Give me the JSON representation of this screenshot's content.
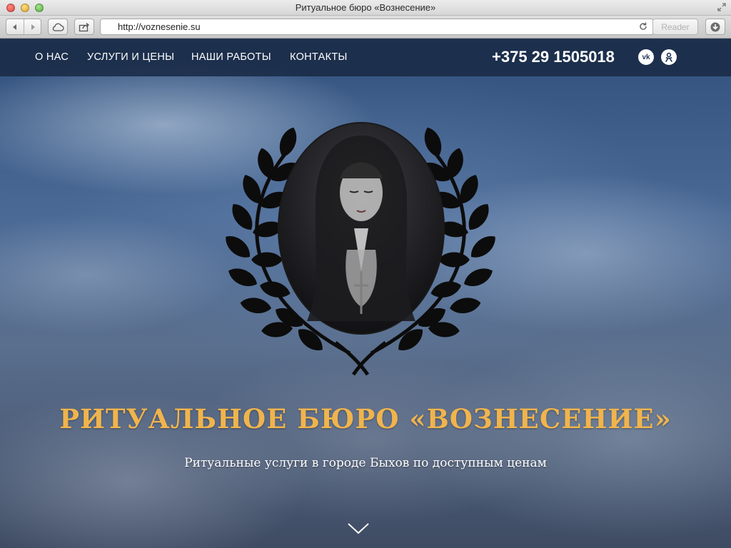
{
  "window": {
    "title": "Ритуальное бюро «Вознесение»"
  },
  "toolbar": {
    "url": "http://voznesenie.su",
    "reader_label": "Reader"
  },
  "nav": {
    "items": [
      {
        "label": "О НАС"
      },
      {
        "label": "УСЛУГИ И ЦЕНЫ"
      },
      {
        "label": "НАШИ РАБОТЫ"
      },
      {
        "label": "КОНТАКТЫ"
      }
    ],
    "phone": "+375 29 1505018",
    "social": [
      {
        "icon": "vk-icon",
        "glyph": "vk"
      },
      {
        "icon": "odnoklassniki-icon",
        "glyph": "ok"
      }
    ]
  },
  "hero": {
    "title": "РИТУАЛЬНОЕ БЮРО «ВОЗНЕСЕНИЕ»",
    "subtitle": "Ритуальные услуги в городе Быхов по доступным ценам"
  },
  "colors": {
    "accent": "#f0b44d",
    "nav_bg": "#192a46",
    "text": "#ffffff"
  }
}
